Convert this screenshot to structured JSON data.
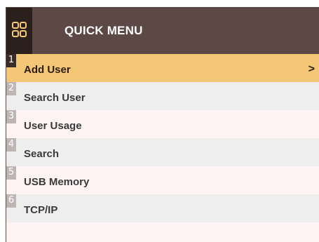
{
  "header": {
    "title": "QUICK MENU",
    "icon": "grid-icon"
  },
  "menu": {
    "items": [
      {
        "number": "1",
        "label": "Add User",
        "selected": true
      },
      {
        "number": "2",
        "label": "Search User",
        "selected": false
      },
      {
        "number": "3",
        "label": "User Usage",
        "selected": false
      },
      {
        "number": "4",
        "label": "Search",
        "selected": false
      },
      {
        "number": "5",
        "label": "USB Memory",
        "selected": false
      },
      {
        "number": "6",
        "label": "TCP/IP",
        "selected": false
      }
    ],
    "selected_arrow": ">"
  },
  "colors": {
    "header_bg": "#5c4945",
    "icon_bg": "#2b201c",
    "icon_accent": "#f4c776",
    "selected_bg": "#f4c776",
    "alt_row_bg": "#eeeeee",
    "row_bg": "#fdf3f3"
  }
}
